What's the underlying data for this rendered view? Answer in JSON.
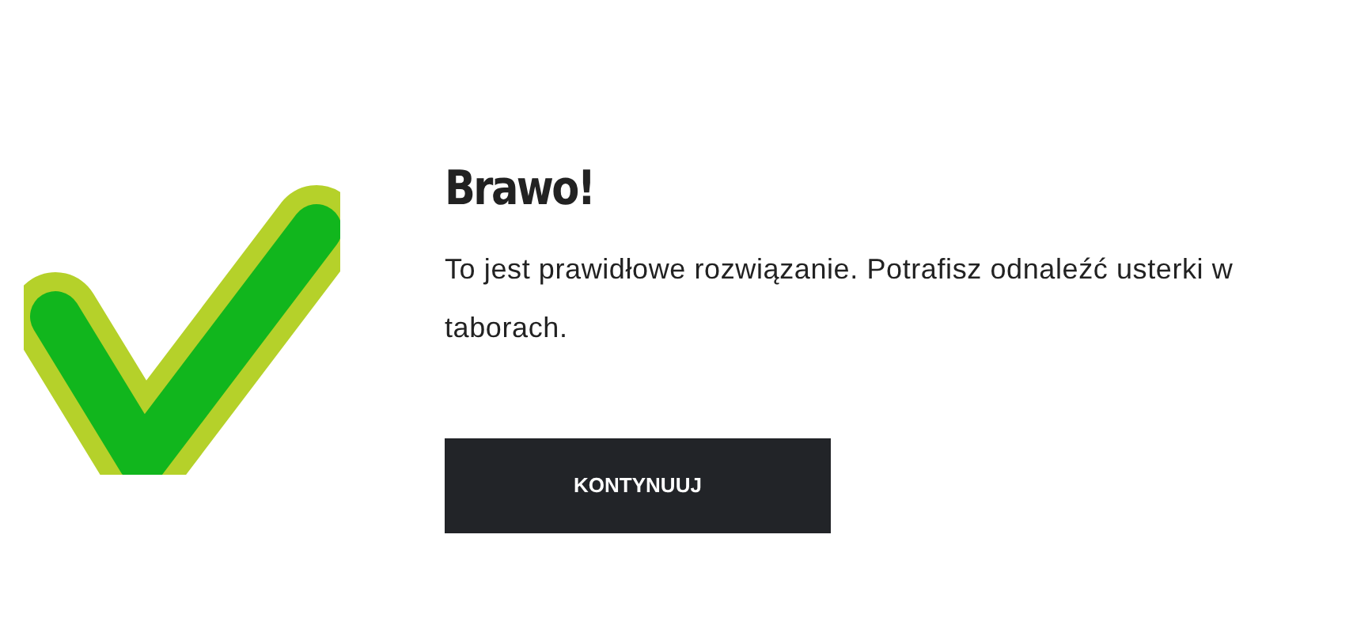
{
  "title": "Brawo!",
  "message": "To jest prawidłowe rozwiązanie. Potrafisz odnaleźć usterki w taborach.",
  "button": "KONTYNUUJ"
}
